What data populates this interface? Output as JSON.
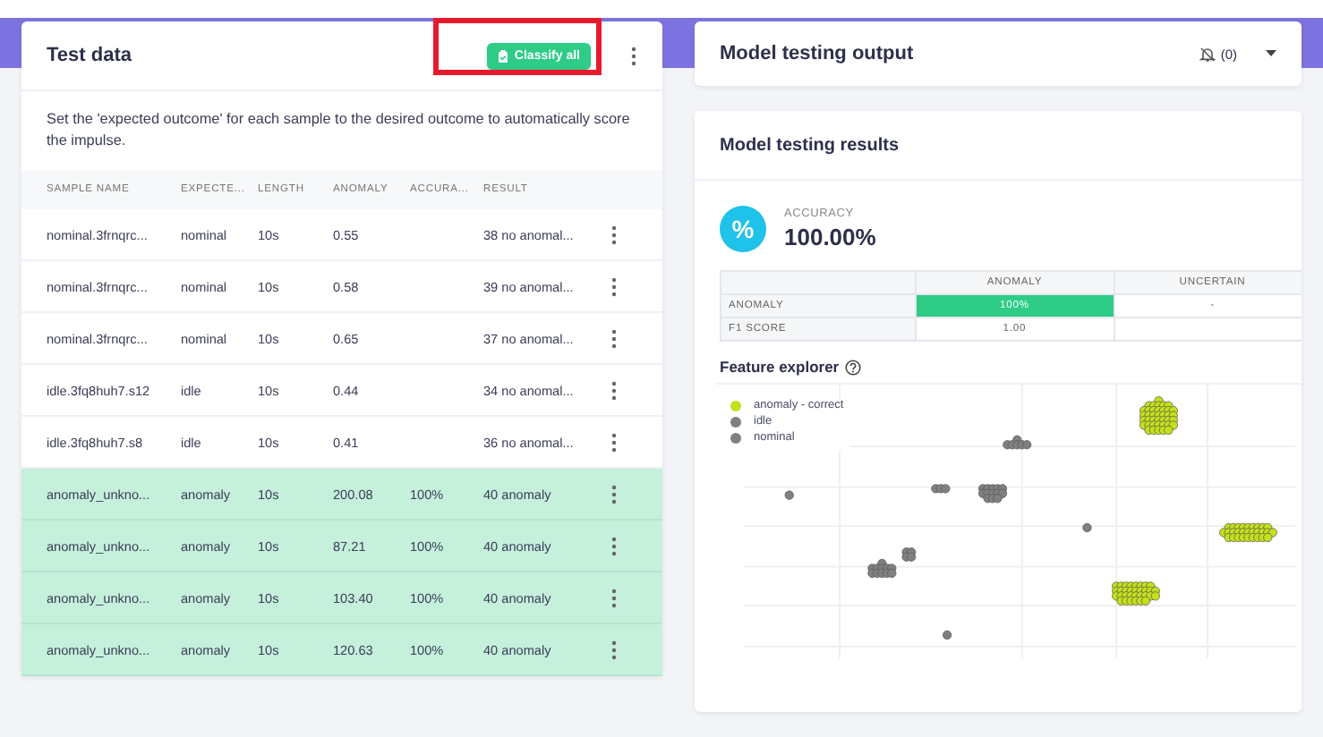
{
  "test_data": {
    "title": "Test data",
    "classify_button": {
      "label": "Classify all",
      "highlighted": true
    },
    "description": "Set the 'expected outcome' for each sample to the desired outcome to automatically score the impulse.",
    "columns": [
      "SAMPLE NAME",
      "EXPECTE...",
      "LENGTH",
      "ANOMALY",
      "ACCURA...",
      "RESULT"
    ],
    "rows": [
      {
        "sample_name": "nominal.3frnqrc...",
        "expected": "nominal",
        "length": "10s",
        "anomaly": "0.55",
        "result": "38 no anomal...",
        "correct": false
      },
      {
        "sample_name": "nominal.3frnqrc...",
        "expected": "nominal",
        "length": "10s",
        "anomaly": "0.58",
        "result": "39 no anomal...",
        "correct": false
      },
      {
        "sample_name": "nominal.3frnqrc...",
        "expected": "nominal",
        "length": "10s",
        "anomaly": "0.65",
        "result": "37 no anomal...",
        "correct": false
      },
      {
        "sample_name": "idle.3fq8huh7.s12",
        "expected": "idle",
        "length": "10s",
        "anomaly": "0.44",
        "result": "34 no anomal...",
        "correct": false
      },
      {
        "sample_name": "idle.3fq8huh7.s8",
        "expected": "idle",
        "length": "10s",
        "anomaly": "0.41",
        "result": "36 no anomal...",
        "correct": false
      },
      {
        "sample_name": "anomaly_unkno...",
        "expected": "anomaly",
        "length": "10s",
        "anomaly": "200.08",
        "accuracy": "100%",
        "result": "40 anomaly",
        "correct": true
      },
      {
        "sample_name": "anomaly_unkno...",
        "expected": "anomaly",
        "length": "10s",
        "anomaly": "87.21",
        "accuracy": "100%",
        "result": "40 anomaly",
        "correct": true
      },
      {
        "sample_name": "anomaly_unkno...",
        "expected": "anomaly",
        "length": "10s",
        "anomaly": "103.40",
        "accuracy": "100%",
        "result": "40 anomaly",
        "correct": true
      },
      {
        "sample_name": "anomaly_unkno...",
        "expected": "anomaly",
        "length": "10s",
        "anomaly": "120.63",
        "accuracy": "100%",
        "result": "40 anomaly",
        "correct": true
      }
    ]
  },
  "output": {
    "title": "Model testing output",
    "alert_count": "(0)"
  },
  "results": {
    "title": "Model testing results",
    "accuracy_glyph": "%",
    "accuracy_label": "ACCURACY",
    "accuracy_value": "100.00%",
    "metrics_table": {
      "columns": [
        "ANOMALY",
        "UNCERTAIN"
      ],
      "rows": [
        {
          "label": "ANOMALY",
          "cells": [
            {
              "text": "100%",
              "highlighted": true
            },
            {
              "text": "-",
              "highlighted": false
            }
          ]
        },
        {
          "label": "F1 SCORE",
          "cells": [
            {
              "text": "1.00",
              "highlighted": false
            }
          ]
        }
      ]
    },
    "feature_explorer": {
      "title": "Feature explorer",
      "legend": [
        {
          "label": "anomaly - correct",
          "color": "#c5e01a"
        },
        {
          "label": "idle",
          "color": "#808080"
        },
        {
          "label": "nominal",
          "color": "#808080"
        }
      ]
    }
  }
}
